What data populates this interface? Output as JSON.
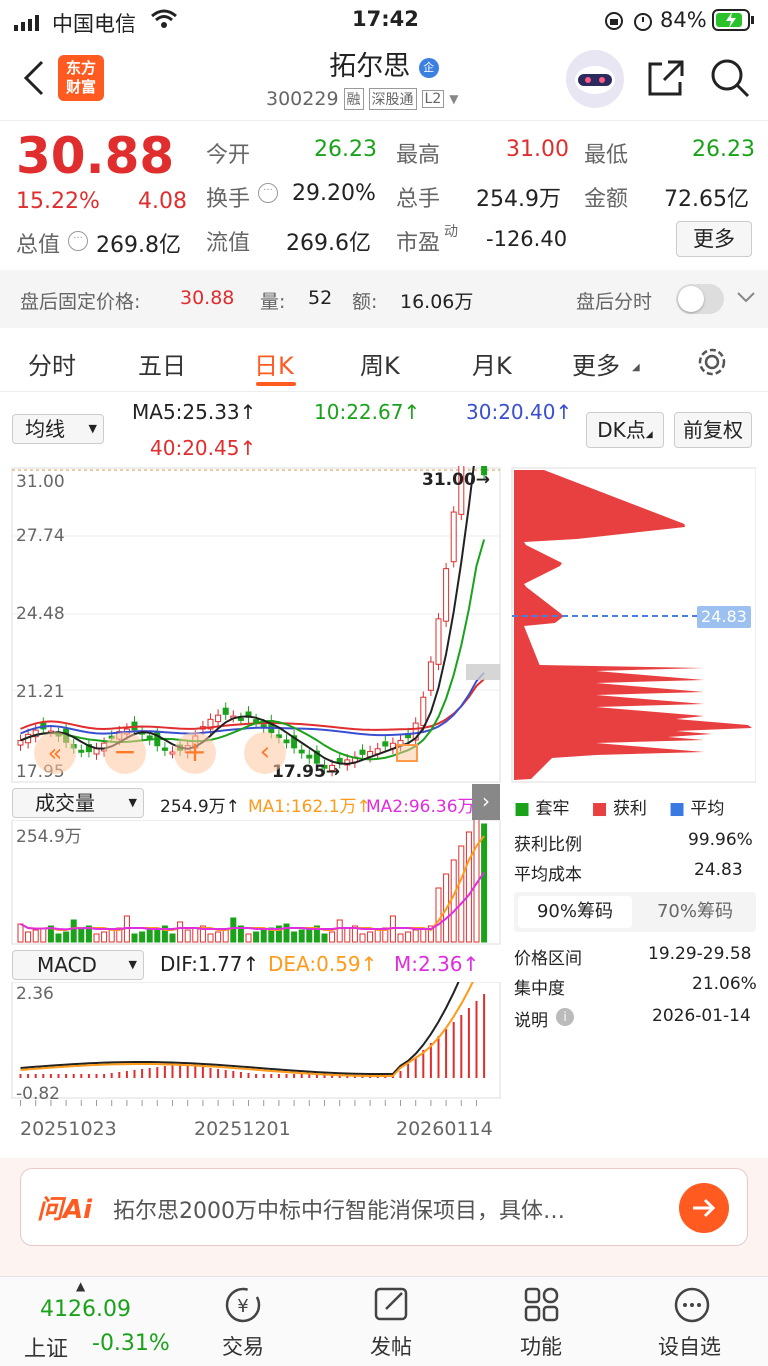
{
  "status": {
    "carrier": "中国电信",
    "time": "17:42",
    "battery": "84%"
  },
  "header": {
    "stock_name": "拓尔思",
    "stock_code": "300229",
    "tag_margin": "融",
    "tag_connect": "深股通",
    "tag_level": "L2",
    "badge": "企"
  },
  "quote": {
    "price": "30.88",
    "change_pct": "15.22%",
    "change": "4.08",
    "open_label": "今开",
    "open": "26.23",
    "high_label": "最高",
    "high": "31.00",
    "low_label": "最低",
    "low": "26.23",
    "turnover_label": "换手",
    "turnover": "29.20%",
    "volume_label": "总手",
    "volume": "254.9万",
    "amount_label": "金额",
    "amount": "72.65亿",
    "mktcap_label": "总值",
    "mktcap": "269.8亿",
    "float_label": "流值",
    "float_cap": "269.6亿",
    "pe_label": "市盈",
    "pe_sup": "动",
    "pe": "-126.40",
    "more_label": "更多"
  },
  "afterhours": {
    "price_label": "盘后固定价格:",
    "price": "30.88",
    "vol_label": "量:",
    "vol": "52",
    "amt_label": "额:",
    "amt": "16.06万",
    "switch_label": "盘后分时"
  },
  "tabs": [
    "分时",
    "五日",
    "日K",
    "周K",
    "月K",
    "更多"
  ],
  "ma_bar": {
    "select": "均线",
    "ma5": "MA5:25.33↑",
    "ma10": "10:22.67↑",
    "ma30": "30:20.40↑",
    "ma40": "40:20.45↑",
    "dk": "DK点",
    "fq": "前复权"
  },
  "price_axis": [
    "31.00",
    "27.74",
    "24.48",
    "21.21",
    "17.95"
  ],
  "annotations": {
    "high_mark": "31.00→",
    "low_mark": "17.95→"
  },
  "volume_bar": {
    "select": "成交量",
    "vol": "254.9万↑",
    "ma1": "MA1:162.1万↑",
    "ma2": "MA2:96.36万↑",
    "axis_top": "254.9万"
  },
  "macd_bar": {
    "select": "MACD",
    "dif": "DIF:1.77↑",
    "dea": "DEA:0.59↑",
    "m": "M:2.36↑",
    "axis_top": "2.36",
    "axis_bottom": "-0.82"
  },
  "dates": [
    "20251023",
    "20251201",
    "20260114"
  ],
  "chip": {
    "cost_tag": "24.83",
    "legend": [
      "套牢",
      "获利",
      "平均"
    ],
    "profit_ratio_label": "获利比例",
    "profit_ratio": "99.96%",
    "avg_cost_label": "平均成本",
    "avg_cost": "24.83",
    "tab_active": "90%筹码",
    "tab_inactive": "70%筹码",
    "range_label": "价格区间",
    "range": "19.29-29.58",
    "concentration_label": "集中度",
    "concentration": "21.06%",
    "note_label": "说明",
    "note_date": "2026-01-14"
  },
  "ai": {
    "logo": "问Ai",
    "text": "拓尔思2000万中标中行智能消保项目，具体…"
  },
  "bottom": {
    "index_value": "4126.09",
    "index_name": "上证",
    "index_change": "-0.31%",
    "items": [
      "交易",
      "发帖",
      "功能",
      "设自选"
    ]
  },
  "colors": {
    "up": "#e02d2d",
    "down": "#1aa21a",
    "ma5": "#222222",
    "ma10": "#1aa21a",
    "ma30": "#3a4fd0",
    "ma40": "#e02d2d",
    "accent": "#ff6a1a"
  }
}
